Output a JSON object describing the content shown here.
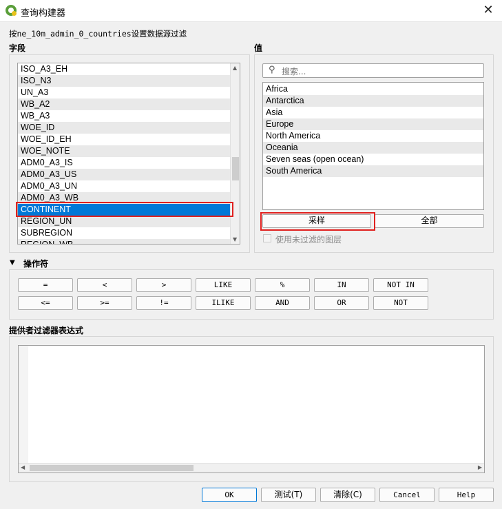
{
  "window": {
    "title": "查询构建器",
    "close_glyph": "✕"
  },
  "subtitle": "按ne_10m_admin_0_countries设置数据源过滤",
  "fields": {
    "label": "字段",
    "items": [
      "ISO_A3_EH",
      "ISO_N3",
      "UN_A3",
      "WB_A2",
      "WB_A3",
      "WOE_ID",
      "WOE_ID_EH",
      "WOE_NOTE",
      "ADM0_A3_IS",
      "ADM0_A3_US",
      "ADM0_A3_UN",
      "ADM0_A3_WB",
      "CONTINENT",
      "REGION_UN",
      "SUBREGION",
      "REGION_WB"
    ],
    "selected": "CONTINENT"
  },
  "values": {
    "label": "值",
    "search_placeholder": "搜索...",
    "items": [
      "Africa",
      "Antarctica",
      "Asia",
      "Europe",
      "North America",
      "Oceania",
      "Seven seas (open ocean)",
      "South America"
    ],
    "sample_label": "采样",
    "all_label": "全部",
    "use_unfiltered_label": "使用未过滤的图层"
  },
  "operators": {
    "label": "操作符",
    "row1": [
      "=",
      "<",
      ">",
      "LIKE",
      "%",
      "IN",
      "NOT IN"
    ],
    "row2": [
      "<=",
      ">=",
      "!=",
      "ILIKE",
      "AND",
      "OR",
      "NOT"
    ]
  },
  "expression": {
    "label": "提供者过滤器表达式",
    "value": ""
  },
  "footer": {
    "ok": "OK",
    "test": "测试(T)",
    "clear": "清除(C)",
    "cancel": "Cancel",
    "help": "Help"
  },
  "colors": {
    "selection": "#0078d7",
    "highlight_box": "#e0201e"
  }
}
